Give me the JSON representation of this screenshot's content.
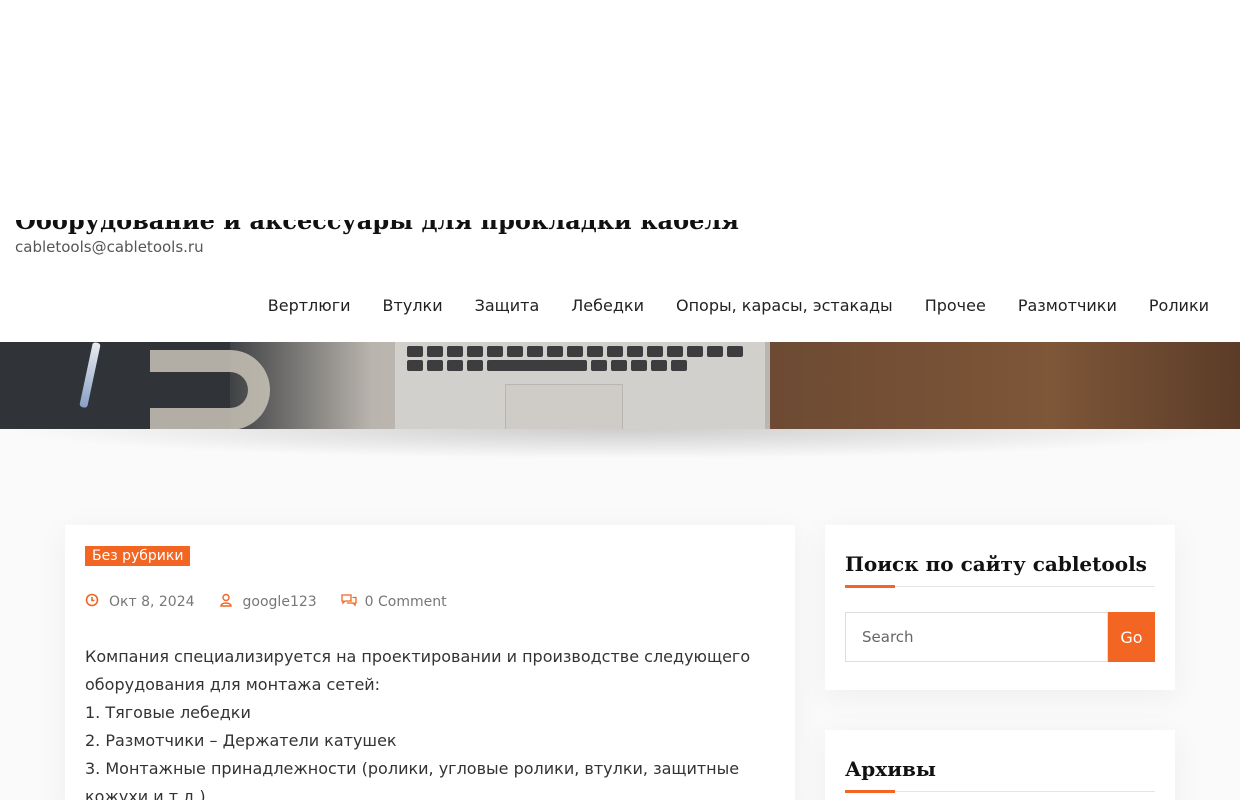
{
  "site": {
    "title": "Оборудование и аксессуары для прокладки кабеля",
    "email": "cabletools@cabletools.ru"
  },
  "nav": {
    "items": [
      {
        "label": "Вертлюги"
      },
      {
        "label": "Втулки"
      },
      {
        "label": "Защита"
      },
      {
        "label": "Лебедки"
      },
      {
        "label": "Опоры, карасы, эстакады"
      },
      {
        "label": "Прочее"
      },
      {
        "label": "Размотчики"
      },
      {
        "label": "Ролики"
      }
    ]
  },
  "post": {
    "category": "Без рубрики",
    "date": "Окт 8, 2024",
    "author": "google123",
    "comments": "0 Comment",
    "paragraphs": [
      "Компания специализируется на проектировании и производстве следующего оборудования для монтажа сетей:",
      "1. Тяговые лебедки",
      "2. Размотчики – Держатели катушек",
      "3. Монтажные принадлежности (ролики, угловые ролики, втулки, защитные кожухи и т.д.)"
    ]
  },
  "sidebar": {
    "search_title": "Поиск по сайту cabletools",
    "search_placeholder": "Search",
    "search_button": "Go",
    "archive_title": "Архивы"
  },
  "colors": {
    "accent": "#f26522"
  },
  "icons": {
    "date": "clock-icon",
    "author": "user-icon",
    "comments": "comments-icon"
  }
}
